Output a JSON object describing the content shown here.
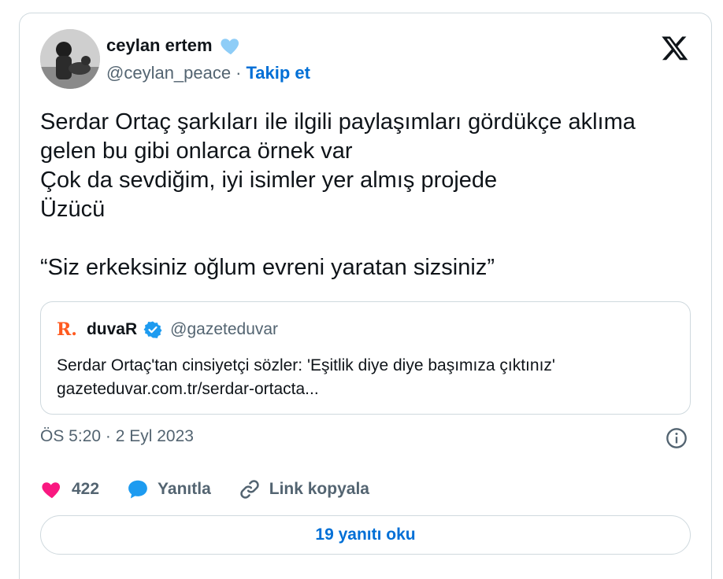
{
  "author": {
    "display_name": "ceylan ertem",
    "handle": "@ceylan_peace",
    "separator": "·",
    "follow_label": "Takip et"
  },
  "tweet": {
    "text": "Serdar Ortaç şarkıları ile ilgili paylaşımları gördükçe aklıma\ngelen bu gibi onlarca örnek var\nÇok da sevdiğim, iyi isimler yer almış projede\nÜzücü\n\n“Siz erkeksiniz oğlum evreni yaratan sizsiniz”"
  },
  "quote": {
    "logo_text": "R.",
    "name": "duvaR",
    "handle": "@gazeteduvar",
    "headline": "Serdar Ortaç'tan cinsiyetçi sözler: 'Eşitlik diye diye başımıza çıktınız'",
    "link": "gazeteduvar.com.tr/serdar-ortacta..."
  },
  "timestamp": "ÖS 5:20 · 2 Eyl 2023",
  "actions": {
    "like_count": "422",
    "reply_label": "Yanıtla",
    "copy_link_label": "Link kopyala"
  },
  "read_replies_label": "19 yanıtı oku",
  "icons": {
    "name_badge": "blue-heart-icon",
    "logo": "x-logo-icon",
    "verified": "verified-badge-icon",
    "info": "info-icon",
    "like": "heart-icon",
    "reply": "speech-bubble-icon",
    "copy_link": "link-icon"
  },
  "colors": {
    "accent": "#006fd6",
    "like": "#f91880",
    "reply": "#1d9bf0",
    "name_badge": "#8ecdf7",
    "duvar_brand": "#ff5a1f",
    "muted": "#536471",
    "border": "#cfd9de"
  }
}
